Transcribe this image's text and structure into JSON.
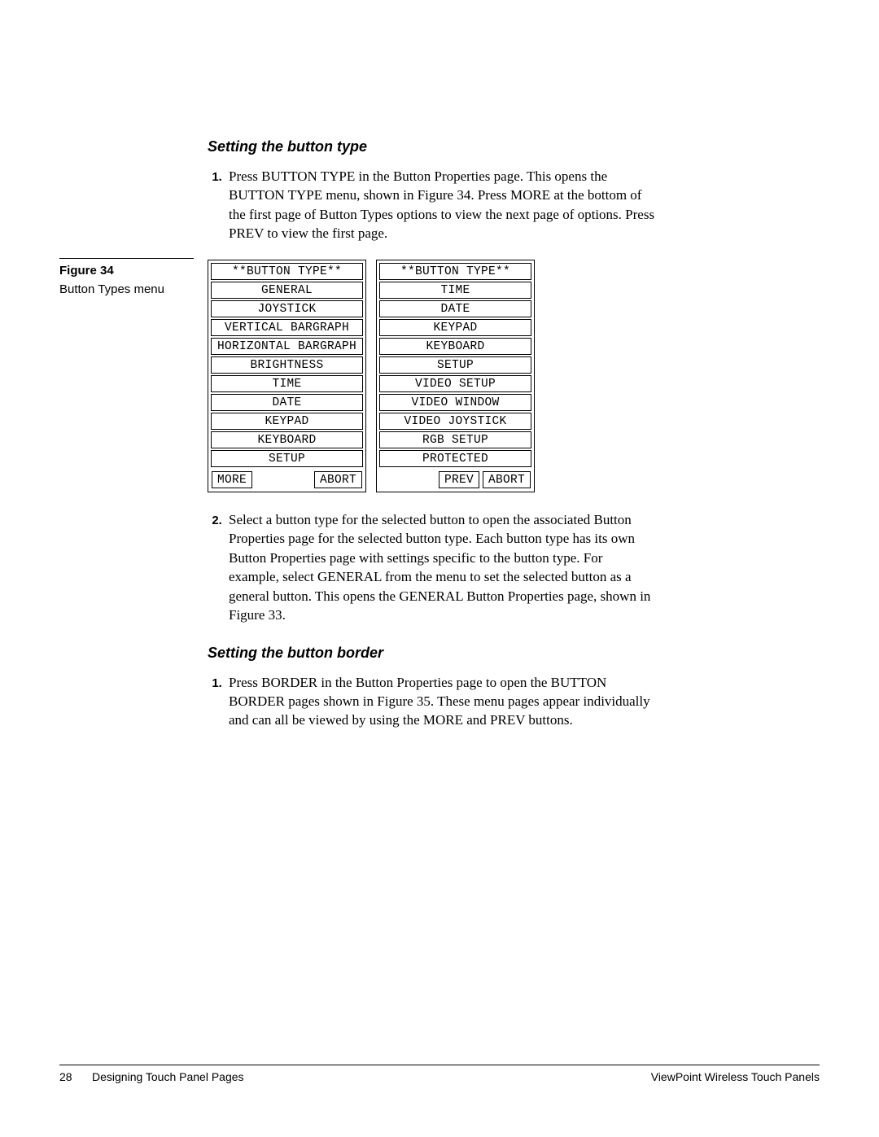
{
  "sections": {
    "s1": {
      "heading": "Setting the button type",
      "step1": "Press BUTTON TYPE in the Button Properties page. This opens the BUTTON TYPE menu, shown in Figure 34. Press MORE at the bottom of the first page of Button Types options to view the next page of options. Press PREV to view the first page.",
      "step2": "Select a button type for the selected button to open the associated Button Properties page for the selected button type. Each button type has its own Button Properties page with settings specific to the button type. For example, select GENERAL from the menu to set the selected button as a general button. This opens the GENERAL Button Properties page, shown in Figure 33."
    },
    "s2": {
      "heading": "Setting the button border",
      "step1": "Press BORDER in the Button Properties page to open the BUTTON BORDER pages shown in Figure 35. These menu pages appear individually and can all be viewed by using the MORE and PREV buttons."
    }
  },
  "figure": {
    "label": "Figure 34",
    "caption": "Button Types menu"
  },
  "menus": {
    "left": {
      "header": "**BUTTON TYPE**",
      "items": [
        "GENERAL",
        "JOYSTICK",
        "VERTICAL BARGRAPH",
        "HORIZONTAL BARGRAPH",
        "BRIGHTNESS",
        "TIME",
        "DATE",
        "KEYPAD",
        "KEYBOARD",
        "SETUP"
      ],
      "nav": {
        "more": "MORE",
        "abort": "ABORT"
      }
    },
    "right": {
      "header": "**BUTTON TYPE**",
      "items": [
        "TIME",
        "DATE",
        "KEYPAD",
        "KEYBOARD",
        "SETUP",
        "VIDEO SETUP",
        "VIDEO WINDOW",
        "VIDEO JOYSTICK",
        "RGB SETUP",
        "PROTECTED"
      ],
      "nav": {
        "prev": "PREV",
        "abort": "ABORT"
      }
    }
  },
  "footer": {
    "page": "28",
    "section": "Designing Touch Panel Pages",
    "doc": "ViewPoint Wireless Touch Panels"
  }
}
